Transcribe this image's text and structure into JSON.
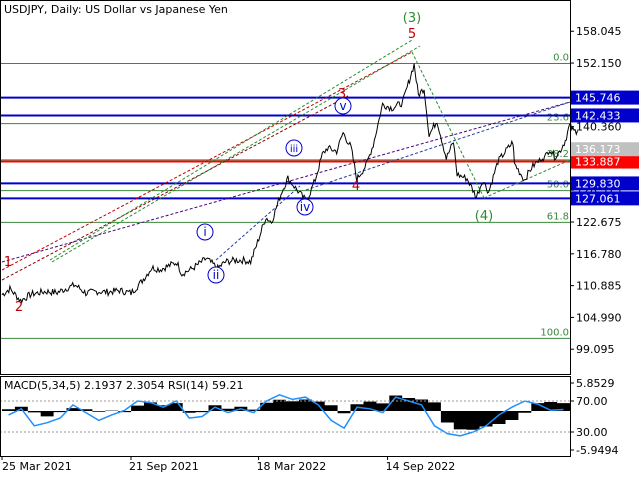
{
  "header": {
    "title": "USDJPY, Daily:  US Dollar vs Japanese Yen"
  },
  "chart_data": {
    "type": "line",
    "symbol": "USDJPY",
    "timeframe": "Daily",
    "price_axis": {
      "range": [
        94.5,
        160.5
      ],
      "ticks": [
        "158.045",
        "152.150",
        "146.255",
        "140.360",
        "134.470",
        "128.575",
        "122.675",
        "116.780",
        "110.885",
        "104.990",
        "99.095"
      ]
    },
    "x_axis": {
      "range": [
        "2021-03-25",
        "2023-04-14"
      ],
      "ticks": [
        {
          "date": "2021-03-25",
          "label": "25 Mar 2021"
        },
        {
          "date": "2021-09-21",
          "label": "21 Sep 2021"
        },
        {
          "date": "2022-03-18",
          "label": "18 Mar 2022"
        },
        {
          "date": "2022-09-14",
          "label": "14 Sep 2022"
        }
      ]
    },
    "price_series": {
      "name": "USDJPY",
      "points": [
        [
          "2021-03-25",
          109.2
        ],
        [
          "2021-04-05",
          110.3
        ],
        [
          "2021-04-20",
          108.1
        ],
        [
          "2021-05-05",
          109.3
        ],
        [
          "2021-05-25",
          109.8
        ],
        [
          "2021-06-10",
          109.6
        ],
        [
          "2021-06-25",
          110.5
        ],
        [
          "2021-07-05",
          111.0
        ],
        [
          "2021-07-20",
          109.5
        ],
        [
          "2021-08-05",
          109.8
        ],
        [
          "2021-08-20",
          109.7
        ],
        [
          "2021-09-05",
          110.0
        ],
        [
          "2021-09-21",
          109.5
        ],
        [
          "2021-10-05",
          111.5
        ],
        [
          "2021-10-20",
          114.2
        ],
        [
          "2021-11-01",
          113.9
        ],
        [
          "2021-11-24",
          115.2
        ],
        [
          "2021-12-01",
          113.1
        ],
        [
          "2021-12-15",
          114.0
        ],
        [
          "2022-01-04",
          115.9
        ],
        [
          "2022-01-20",
          114.1
        ],
        [
          "2022-01-31",
          115.3
        ],
        [
          "2022-02-15",
          115.6
        ],
        [
          "2022-02-25",
          115.6
        ],
        [
          "2022-03-07",
          115.3
        ],
        [
          "2022-03-15",
          118.3
        ],
        [
          "2022-03-28",
          123.5
        ],
        [
          "2022-04-05",
          122.7
        ],
        [
          "2022-04-20",
          128.5
        ],
        [
          "2022-04-28",
          130.8
        ],
        [
          "2022-05-12",
          128.4
        ],
        [
          "2022-05-24",
          126.5
        ],
        [
          "2022-06-05",
          130.5
        ],
        [
          "2022-06-15",
          135.2
        ],
        [
          "2022-06-22",
          136.4
        ],
        [
          "2022-07-05",
          135.8
        ],
        [
          "2022-07-14",
          139.2
        ],
        [
          "2022-07-25",
          136.5
        ],
        [
          "2022-08-02",
          130.6
        ],
        [
          "2022-08-15",
          133.2
        ],
        [
          "2022-08-25",
          137.0
        ],
        [
          "2022-09-07",
          144.5
        ],
        [
          "2022-09-20",
          143.8
        ],
        [
          "2022-10-05",
          144.8
        ],
        [
          "2022-10-21",
          151.9
        ],
        [
          "2022-10-27",
          146.2
        ],
        [
          "2022-11-04",
          147.5
        ],
        [
          "2022-11-11",
          138.8
        ],
        [
          "2022-11-22",
          141.5
        ],
        [
          "2022-12-05",
          134.5
        ],
        [
          "2022-12-15",
          137.5
        ],
        [
          "2022-12-20",
          131.5
        ],
        [
          "2023-01-03",
          130.7
        ],
        [
          "2023-01-16",
          127.3
        ],
        [
          "2023-01-25",
          130.5
        ],
        [
          "2023-02-02",
          128.2
        ],
        [
          "2023-02-15",
          133.9
        ],
        [
          "2023-02-28",
          136.2
        ],
        [
          "2023-03-08",
          137.5
        ],
        [
          "2023-03-10",
          133.5
        ],
        [
          "2023-03-24",
          130.5
        ],
        [
          "2023-04-03",
          132.8
        ],
        [
          "2023-04-10",
          133.7
        ],
        [
          "2023-04-14",
          134.0
        ],
        [
          "2023-04-18",
          134.8
        ],
        [
          "2023-04-21",
          134.5
        ],
        [
          "2023-04-28",
          136.3
        ],
        [
          "2023-05-05",
          134.8
        ],
        [
          "2023-05-12",
          135.7
        ],
        [
          "2023-05-20",
          137.8
        ],
        [
          "2023-05-26",
          140.6
        ],
        [
          "2023-06-01",
          139.5
        ],
        [
          "2023-06-06",
          139.6
        ]
      ]
    },
    "horizontal_levels": [
      {
        "price": 145.746,
        "label": "145.746",
        "color": "#0000cc"
      },
      {
        "price": 142.433,
        "label": "142.433",
        "color": "#0000cc"
      },
      {
        "price": 133.887,
        "label": "133.887",
        "color": "#ff0000"
      },
      {
        "price": 129.83,
        "label": "129.830",
        "color": "#0000cc"
      },
      {
        "price": 127.061,
        "label": "127.061",
        "color": "#0000cc"
      }
    ],
    "current_price": {
      "label": "136.173",
      "color": "#c0c0c0"
    },
    "fibonacci": [
      {
        "level": "0.0",
        "price": 152.15
      },
      {
        "level": "23.6",
        "price": 141.0
      },
      {
        "level": "38.2",
        "price": 134.3
      },
      {
        "level": "50.0",
        "price": 128.6
      },
      {
        "level": "61.8",
        "price": 122.7
      },
      {
        "level": "100.0",
        "price": 101.2
      }
    ],
    "wave_labels": [
      {
        "text": "1",
        "color": "#c00000"
      },
      {
        "text": "2",
        "color": "#c00000"
      },
      {
        "text": "3",
        "color": "#c00000"
      },
      {
        "text": "4",
        "color": "#c00000"
      },
      {
        "text": "5",
        "color": "#c00000"
      },
      {
        "text": "(3)",
        "color": "#2e8b2e"
      },
      {
        "text": "(4)",
        "color": "#2e8b2e"
      },
      {
        "text": "i",
        "color": "#0000cc"
      },
      {
        "text": "ii",
        "color": "#0000cc"
      },
      {
        "text": "iii",
        "color": "#0000cc"
      },
      {
        "text": "iv",
        "color": "#0000cc"
      },
      {
        "text": "v",
        "color": "#0000cc"
      }
    ],
    "indicator": {
      "label": "MACD(5,34,5) 2.1937 2.3054 RSI(14) 59.21",
      "axis_ticks": [
        "5.8529",
        "70.00",
        "30.00",
        "-5.9494"
      ],
      "histogram": [
        0.5,
        1.2,
        -0.4,
        -1.5,
        -0.3,
        0.8,
        0.5,
        -0.2,
        0.1,
        -0.3,
        1.5,
        2.4,
        1.6,
        2.2,
        -0.5,
        -0.3,
        1.6,
        0.6,
        1.2,
        0.4,
        2.3,
        3.1,
        2.7,
        3.2,
        2.6,
        1.6,
        -0.6,
        1.9,
        2.6,
        2.1,
        4.3,
        3.6,
        3.2,
        2.4,
        -3.2,
        -5.1,
        -5.2,
        -4.3,
        -3.6,
        -2.5,
        -0.5,
        2.2,
        2.5,
        2.2
      ],
      "rsi": [
        52,
        60,
        38,
        42,
        48,
        65,
        55,
        45,
        52,
        58,
        70,
        68,
        62,
        70,
        48,
        50,
        62,
        55,
        60,
        55,
        70,
        78,
        72,
        75,
        65,
        45,
        35,
        62,
        60,
        55,
        75,
        70,
        65,
        38,
        28,
        25,
        30,
        38,
        52,
        62,
        70,
        66,
        58,
        59
      ]
    },
    "grid": false,
    "colors": {
      "price": "#000000",
      "fibo": "#3a8a3a",
      "accent_blue": "#0000cc",
      "accent_red": "#ff0000"
    }
  }
}
